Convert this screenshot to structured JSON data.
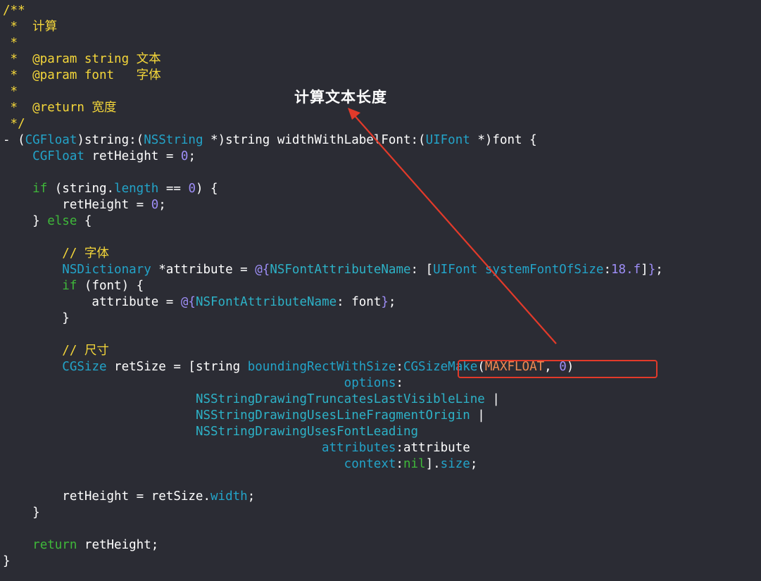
{
  "editor": {
    "lines": [
      [
        {
          "t": "/**",
          "c": "comment"
        }
      ],
      [
        {
          "t": " *  计算",
          "c": "comment"
        }
      ],
      [
        {
          "t": " *",
          "c": "comment"
        }
      ],
      [
        {
          "t": " *  @param string 文本",
          "c": "comment"
        }
      ],
      [
        {
          "t": " *  @param font   字体",
          "c": "comment"
        }
      ],
      [
        {
          "t": " *",
          "c": "comment"
        }
      ],
      [
        {
          "t": " *  @return 宽度",
          "c": "comment"
        }
      ],
      [
        {
          "t": " */",
          "c": "comment"
        }
      ],
      [
        {
          "t": "- (",
          "c": "plain"
        },
        {
          "t": "CGFloat",
          "c": "type"
        },
        {
          "t": ")string:(",
          "c": "plain"
        },
        {
          "t": "NSString",
          "c": "type"
        },
        {
          "t": " *)string widthWithLabelFont:(",
          "c": "plain"
        },
        {
          "t": "UIFont",
          "c": "type"
        },
        {
          "t": " *)font {",
          "c": "plain"
        }
      ],
      [
        {
          "t": "    ",
          "c": "plain"
        },
        {
          "t": "CGFloat",
          "c": "type"
        },
        {
          "t": " retHeight = ",
          "c": "plain"
        },
        {
          "t": "0",
          "c": "number"
        },
        {
          "t": ";",
          "c": "plain"
        }
      ],
      [],
      [
        {
          "t": "    ",
          "c": "plain"
        },
        {
          "t": "if",
          "c": "keyword"
        },
        {
          "t": " (string.",
          "c": "plain"
        },
        {
          "t": "length",
          "c": "method"
        },
        {
          "t": " == ",
          "c": "plain"
        },
        {
          "t": "0",
          "c": "number"
        },
        {
          "t": ") {",
          "c": "plain"
        }
      ],
      [
        {
          "t": "        retHeight = ",
          "c": "plain"
        },
        {
          "t": "0",
          "c": "number"
        },
        {
          "t": ";",
          "c": "plain"
        }
      ],
      [
        {
          "t": "    } ",
          "c": "plain"
        },
        {
          "t": "else",
          "c": "keyword"
        },
        {
          "t": " {",
          "c": "plain"
        }
      ],
      [],
      [
        {
          "t": "        // 字体",
          "c": "comment"
        }
      ],
      [
        {
          "t": "        ",
          "c": "plain"
        },
        {
          "t": "NSDictionary",
          "c": "type"
        },
        {
          "t": " *attribute = ",
          "c": "plain"
        },
        {
          "t": "@{",
          "c": "number"
        },
        {
          "t": "NSFontAttributeName",
          "c": "nsconst"
        },
        {
          "t": ": [",
          "c": "plain"
        },
        {
          "t": "UIFont",
          "c": "type"
        },
        {
          "t": " ",
          "c": "plain"
        },
        {
          "t": "systemFontOfSize",
          "c": "method"
        },
        {
          "t": ":",
          "c": "plain"
        },
        {
          "t": "18.f",
          "c": "number"
        },
        {
          "t": "]",
          "c": "plain"
        },
        {
          "t": "}",
          "c": "number"
        },
        {
          "t": ";",
          "c": "plain"
        }
      ],
      [
        {
          "t": "        ",
          "c": "plain"
        },
        {
          "t": "if",
          "c": "keyword"
        },
        {
          "t": " (font) {",
          "c": "plain"
        }
      ],
      [
        {
          "t": "            attribute = ",
          "c": "plain"
        },
        {
          "t": "@{",
          "c": "number"
        },
        {
          "t": "NSFontAttributeName",
          "c": "nsconst"
        },
        {
          "t": ": font",
          "c": "plain"
        },
        {
          "t": "}",
          "c": "number"
        },
        {
          "t": ";",
          "c": "plain"
        }
      ],
      [
        {
          "t": "        }",
          "c": "plain"
        }
      ],
      [],
      [
        {
          "t": "        // 尺寸",
          "c": "comment"
        }
      ],
      [
        {
          "t": "        ",
          "c": "plain"
        },
        {
          "t": "CGSize",
          "c": "type"
        },
        {
          "t": " retSize = [string ",
          "c": "plain"
        },
        {
          "t": "boundingRectWithSize",
          "c": "method"
        },
        {
          "t": ":",
          "c": "plain"
        },
        {
          "t": "CGSizeMake",
          "c": "type"
        },
        {
          "t": "(",
          "c": "plain"
        },
        {
          "t": "MAXFLOAT",
          "c": "macro"
        },
        {
          "t": ", ",
          "c": "plain"
        },
        {
          "t": "0",
          "c": "number"
        },
        {
          "t": ")",
          "c": "plain"
        }
      ],
      [
        {
          "t": "                                              ",
          "c": "plain"
        },
        {
          "t": "options",
          "c": "method"
        },
        {
          "t": ":",
          "c": "plain"
        }
      ],
      [
        {
          "t": "                          ",
          "c": "plain"
        },
        {
          "t": "NSStringDrawingTruncatesLastVisibleLine",
          "c": "nsconst"
        },
        {
          "t": " |",
          "c": "plain"
        }
      ],
      [
        {
          "t": "                          ",
          "c": "plain"
        },
        {
          "t": "NSStringDrawingUsesLineFragmentOrigin",
          "c": "nsconst"
        },
        {
          "t": " |",
          "c": "plain"
        }
      ],
      [
        {
          "t": "                          ",
          "c": "plain"
        },
        {
          "t": "NSStringDrawingUsesFontLeading",
          "c": "nsconst"
        }
      ],
      [
        {
          "t": "                                           ",
          "c": "plain"
        },
        {
          "t": "attributes",
          "c": "method"
        },
        {
          "t": ":attribute",
          "c": "plain"
        }
      ],
      [
        {
          "t": "                                              ",
          "c": "plain"
        },
        {
          "t": "context",
          "c": "method"
        },
        {
          "t": ":",
          "c": "plain"
        },
        {
          "t": "nil",
          "c": "keyword"
        },
        {
          "t": "].",
          "c": "plain"
        },
        {
          "t": "size",
          "c": "method"
        },
        {
          "t": ";",
          "c": "plain"
        }
      ],
      [],
      [
        {
          "t": "        retHeight = retSize.",
          "c": "plain"
        },
        {
          "t": "width",
          "c": "method"
        },
        {
          "t": ";",
          "c": "plain"
        }
      ],
      [
        {
          "t": "    }",
          "c": "plain"
        }
      ],
      [],
      [
        {
          "t": "    ",
          "c": "plain"
        },
        {
          "t": "return",
          "c": "keyword"
        },
        {
          "t": " retHeight;",
          "c": "plain"
        }
      ],
      [
        {
          "t": "}",
          "c": "plain"
        }
      ]
    ]
  },
  "annotation": {
    "label": "计算文本长度",
    "arrow_color": "#e23a2a",
    "box_color": "#e23a2a"
  },
  "colors": {
    "background": "#2b2c34",
    "plain": "#ffffff",
    "comment": "#f5d73a",
    "type": "#23a4c9",
    "keyword": "#3fb83a",
    "number": "#9e8ef7",
    "macro": "#f08a52"
  }
}
